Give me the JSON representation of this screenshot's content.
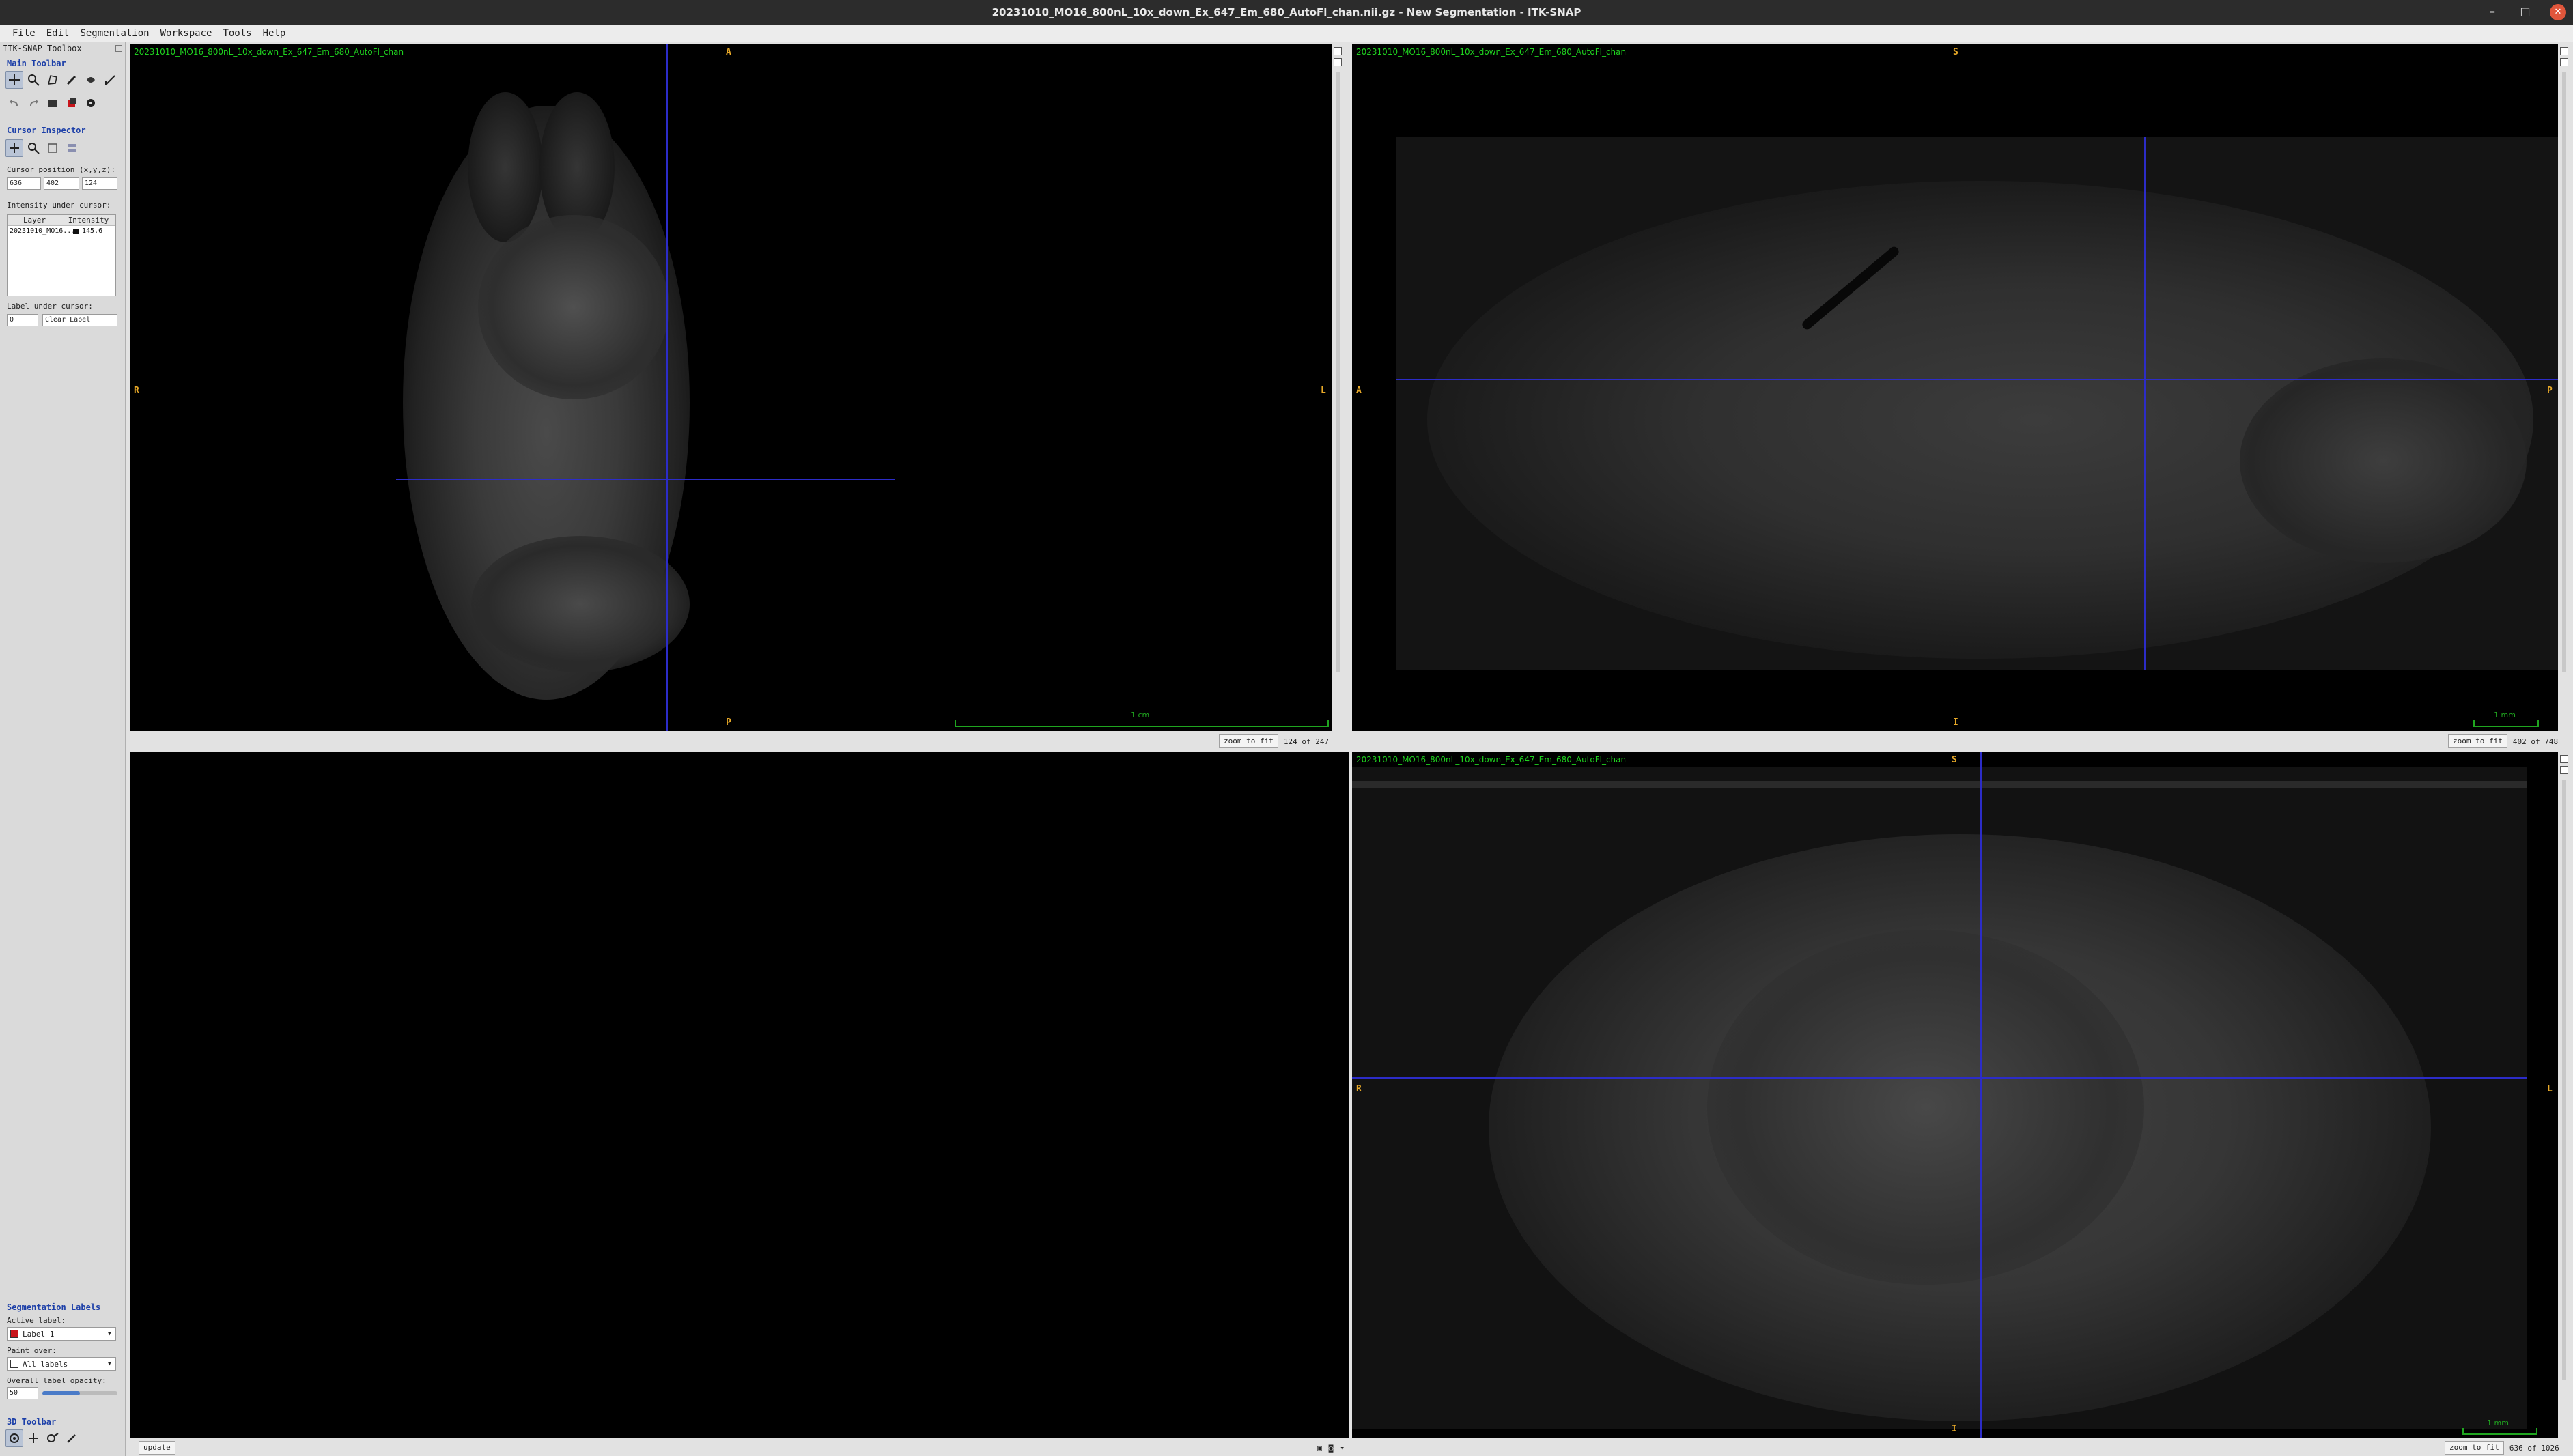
{
  "window": {
    "title": "20231010_MO16_800nL_10x_down_Ex_647_Em_680_AutoFl_chan.nii.gz - New Segmentation - ITK-SNAP",
    "minimize_glyph": "–",
    "maximize_glyph": "□",
    "close_glyph": "✕"
  },
  "menubar": [
    "File",
    "Edit",
    "Segmentation",
    "Workspace",
    "Tools",
    "Help"
  ],
  "toolbox": {
    "title": "ITK-SNAP Toolbox",
    "main_toolbar": {
      "title": "Main Toolbar",
      "tools": [
        "crosshair-icon",
        "zoom-icon",
        "polygon-icon",
        "paintbrush-icon",
        "snake-icon",
        "ruler-icon"
      ],
      "actions": [
        "undo-icon",
        "redo-icon",
        "layer-icon",
        "segment-3d-icon",
        "gear-icon"
      ]
    },
    "cursor_inspector": {
      "title": "Cursor Inspector",
      "position_label": "Cursor position (x,y,z):",
      "x": "636",
      "y": "402",
      "z": "124",
      "intensity_label": "Intensity under cursor:",
      "col_layer": "Layer",
      "col_intensity": "Intensity",
      "rows": [
        {
          "layer": "20231010_MO16...",
          "intensity": "145.6"
        }
      ],
      "label_under_label": "Label under cursor:",
      "label_id": "0",
      "label_name": "Clear Label"
    },
    "segmentation_labels": {
      "title": "Segmentation Labels",
      "active_label_caption": "Active label:",
      "active_label": "Label 1",
      "active_label_color": "#c8151b",
      "paint_over_caption": "Paint over:",
      "paint_over": "All labels",
      "opacity_caption": "Overall label opacity:",
      "opacity_value": "50",
      "opacity_fraction": 0.5
    },
    "toolbar_3d": {
      "title": "3D Toolbar"
    }
  },
  "views": {
    "layer_name": "20231010_MO16_800nL_10x_down_Ex_647_Em_680_AutoFl_chan",
    "axial": {
      "top": "A",
      "bottom": "P",
      "left": "R",
      "right": "L",
      "scale": "1 cm",
      "zoom_btn": "zoom to fit",
      "slice": "124 of 247"
    },
    "sagittal": {
      "top": "S",
      "bottom": "I",
      "left": "A",
      "right": "P",
      "scale": "1 mm",
      "zoom_btn": "zoom to fit",
      "slice": "402 of 748"
    },
    "coronal": {
      "top": "S",
      "bottom": "I",
      "left": "R",
      "right": "L",
      "scale": "1 mm",
      "zoom_btn": "zoom to fit",
      "slice": "636 of 1026"
    },
    "view3d": {
      "update_btn": "update"
    }
  },
  "colors": {
    "crosshair": "#2c2cc8",
    "orientation": "#e8a928",
    "layer_text": "#1fd21f"
  }
}
